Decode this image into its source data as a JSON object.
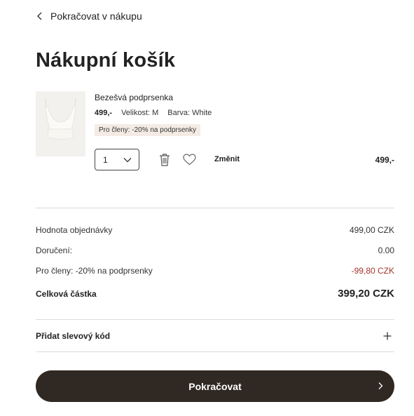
{
  "nav": {
    "back_label": "Pokračovat v nákupu"
  },
  "page": {
    "title": "Nákupní košík"
  },
  "cart_item": {
    "name": "Bezešvá podprsenka",
    "price": "499,-",
    "size_label": "Velikost:",
    "size_value": "M",
    "color_label": "Barva:",
    "color_value": "White",
    "promo_badge": "Pro členy: -20% na podprsenky",
    "quantity": "1",
    "change_label": "Změnit",
    "line_total": "499,-"
  },
  "summary": {
    "order_value_label": "Hodnota objednávky",
    "order_value": "499,00 CZK",
    "delivery_label": "Doručení:",
    "delivery_value": "0.00",
    "member_discount_label": "Pro členy: -20% na podprsenky",
    "member_discount_value": "-99,80 CZK",
    "total_label": "Celková částka",
    "total_value": "399,20 CZK"
  },
  "discount_code": {
    "label": "Přidat slevový kód"
  },
  "checkout": {
    "button_label": "Pokračovat"
  },
  "colors": {
    "primary_button": "#302923",
    "promo_background": "#f4ece4",
    "discount_text": "#a4332c",
    "divider": "#dcdcdc"
  },
  "icons": [
    "chevron-left-icon",
    "chevron-down-icon",
    "trash-icon",
    "heart-icon",
    "plus-icon",
    "chevron-right-icon"
  ]
}
